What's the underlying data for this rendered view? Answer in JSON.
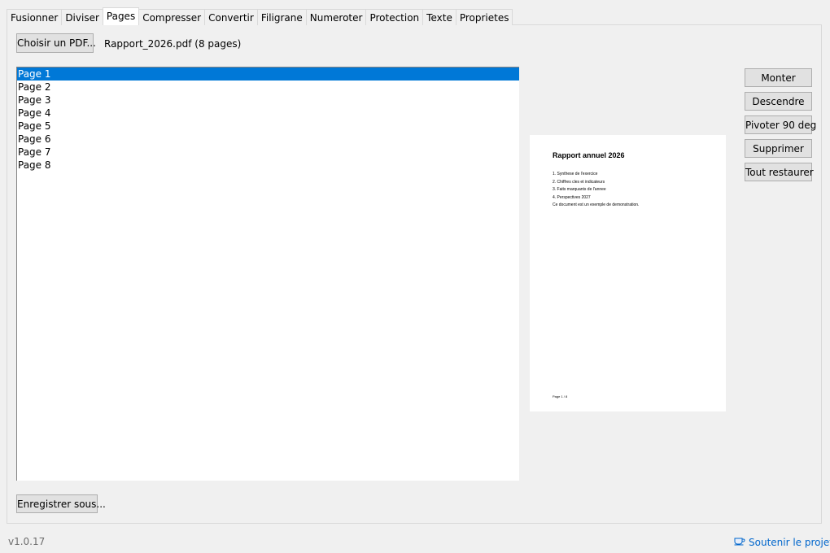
{
  "tabs": [
    {
      "label": "Fusionner",
      "active": false
    },
    {
      "label": "Diviser",
      "active": false
    },
    {
      "label": "Pages",
      "active": true
    },
    {
      "label": "Compresser",
      "active": false
    },
    {
      "label": "Convertir",
      "active": false
    },
    {
      "label": "Filigrane",
      "active": false
    },
    {
      "label": "Numeroter",
      "active": false
    },
    {
      "label": "Protection",
      "active": false
    },
    {
      "label": "Texte",
      "active": false
    },
    {
      "label": "Proprietes",
      "active": false
    }
  ],
  "toolbar": {
    "choose_pdf_label": "Choisir un PDF...",
    "file_info": "Rapport_2026.pdf (8 pages)"
  },
  "page_list": {
    "items": [
      "Page 1",
      "Page 2",
      "Page 3",
      "Page 4",
      "Page 5",
      "Page 6",
      "Page 7",
      "Page 8"
    ],
    "selected": "Page 1"
  },
  "actions": {
    "move_up": "Monter",
    "move_down": "Descendre",
    "rotate": "Pivoter 90 deg",
    "delete": "Supprimer",
    "restore_all": "Tout restaurer"
  },
  "preview": {
    "title": "Rapport annuel 2026",
    "lines": [
      "1. Synthese de l'exercice",
      "2. Chiffres cles et indicateurs",
      "3. Faits marquants de l'annee",
      "4. Perspectives 2027",
      "Ce document est un exemple de demonstration."
    ],
    "footer": "Page 1 / 8"
  },
  "save_as_label": "Enregistrer sous...",
  "footer": {
    "version": "v1.0.17",
    "support_link": "Soutenir le projet",
    "support_icon": "coffee-cup-icon"
  },
  "colors": {
    "selection": "#0078d7",
    "link": "#0066cc"
  }
}
